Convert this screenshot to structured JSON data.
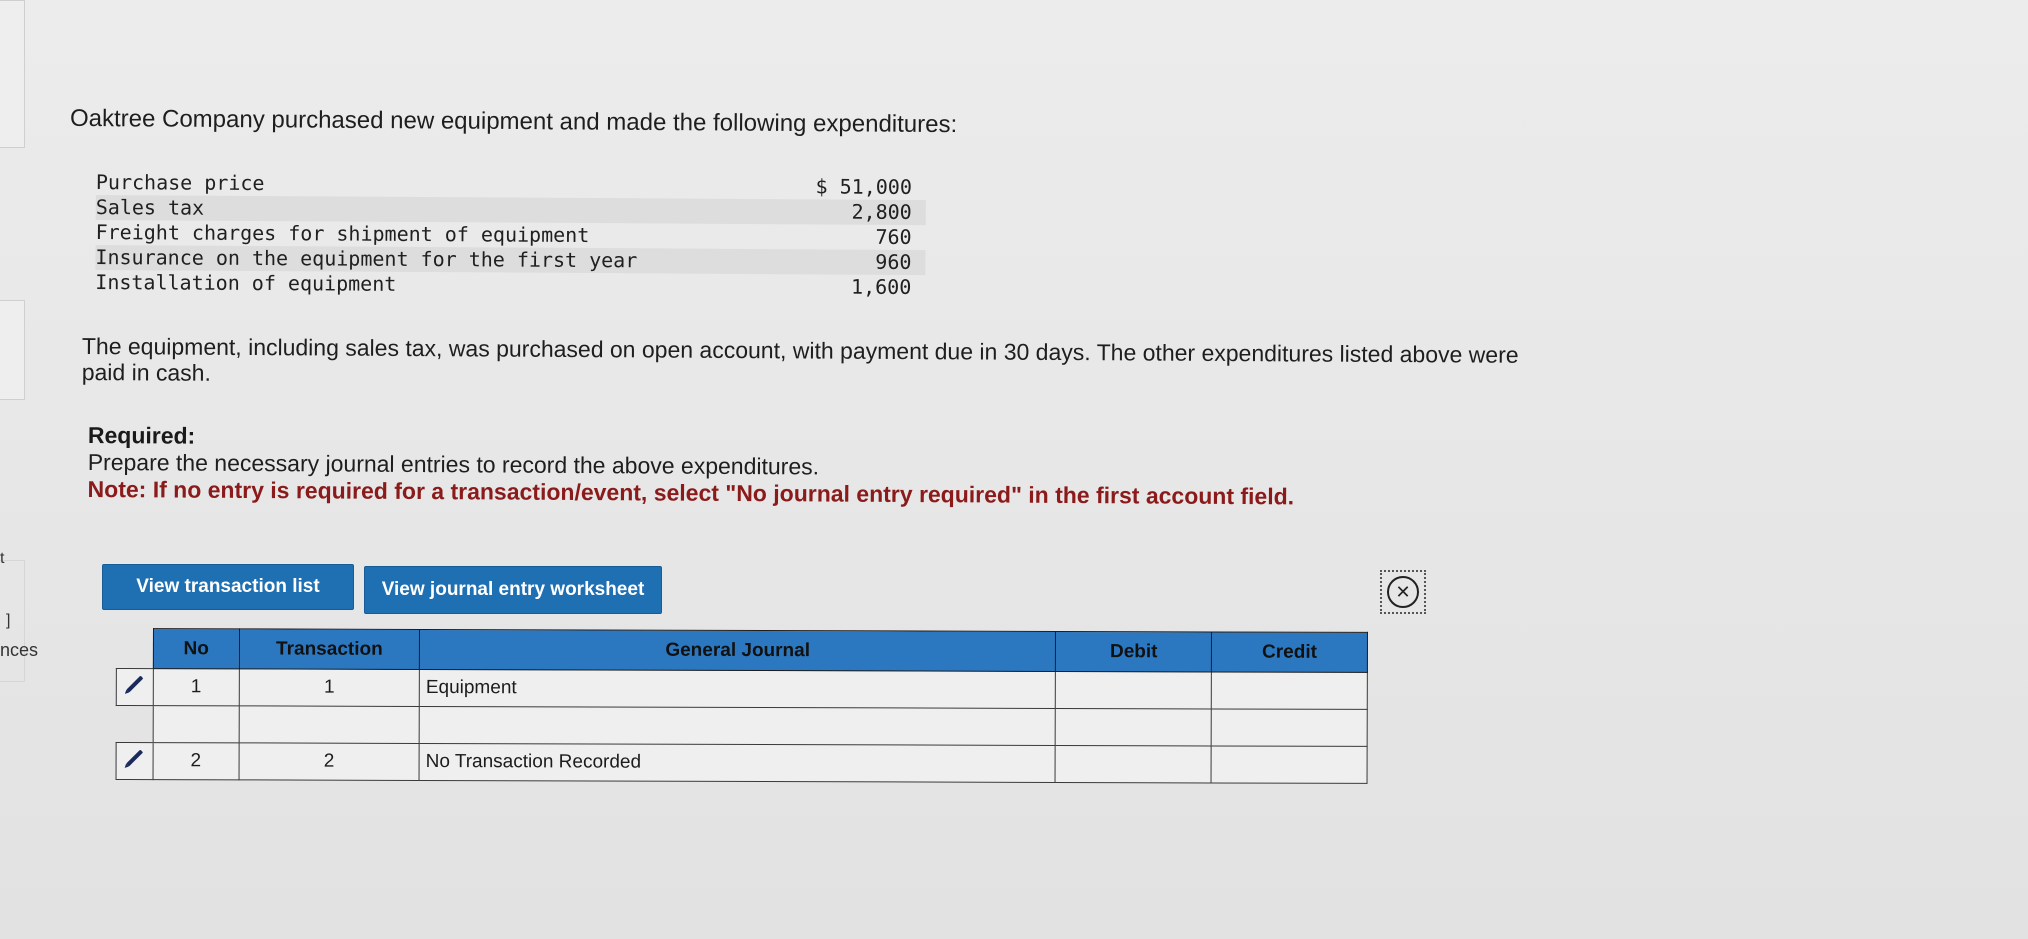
{
  "left_rail": {
    "partial_text": "nces",
    "mark_top": "t",
    "mark_bracket": "]"
  },
  "problem": {
    "intro": "Oaktree Company purchased new equipment and made the following expenditures:",
    "expenditures": [
      {
        "label": "Purchase price",
        "amount": "$ 51,000"
      },
      {
        "label": "Sales tax",
        "amount": "2,800"
      },
      {
        "label": "Freight charges for shipment of equipment",
        "amount": "760"
      },
      {
        "label": "Insurance on the equipment for the first year",
        "amount": "960"
      },
      {
        "label": "Installation of equipment",
        "amount": "1,600"
      }
    ],
    "paragraph": "The equipment, including sales tax, was purchased on open account, with payment due in 30 days. The other expenditures listed above were paid in cash."
  },
  "required": {
    "title": "Required:",
    "instruction": "Prepare the necessary journal entries to record the above expenditures.",
    "note": "Note: If no entry is required for a transaction/event, select \"No journal entry required\" in the first account field."
  },
  "buttons": {
    "view_transaction_list": "View transaction list",
    "view_journal_worksheet": "View journal entry worksheet",
    "close_symbol": "✕"
  },
  "journal_table": {
    "headers": {
      "no": "No",
      "transaction": "Transaction",
      "general_journal": "General Journal",
      "debit": "Debit",
      "credit": "Credit"
    },
    "rows": [
      {
        "no": "1",
        "transaction": "1",
        "account": "Equipment",
        "debit": "",
        "credit": ""
      },
      {
        "no": "",
        "transaction": "",
        "account": "",
        "debit": "",
        "credit": ""
      },
      {
        "no": "2",
        "transaction": "2",
        "account": "No Transaction Recorded",
        "debit": "",
        "credit": ""
      }
    ]
  },
  "colors": {
    "button_blue": "#1f6fb3",
    "header_blue": "#2b78c0",
    "note_red": "#8b1a1a"
  }
}
